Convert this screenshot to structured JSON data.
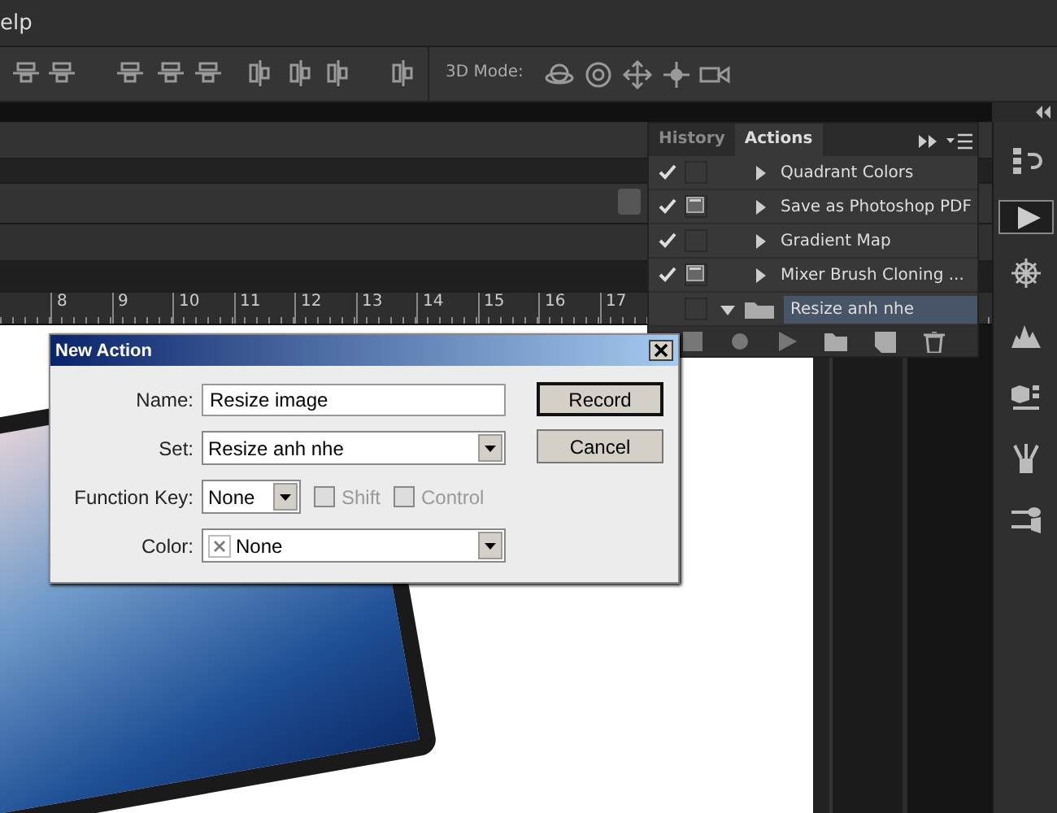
{
  "menu_bar": {
    "partial_item": "elp"
  },
  "options_bar": {
    "mode_label": "3D Mode:"
  },
  "ruler": {
    "ticks": [
      "8",
      "9",
      "10",
      "11",
      "12",
      "13",
      "14",
      "15",
      "16",
      "17"
    ]
  },
  "actions_panel": {
    "tabs": [
      {
        "label": "History",
        "selected": false
      },
      {
        "label": "Actions",
        "selected": true
      }
    ],
    "items": [
      {
        "kind": "action",
        "name": "Quadrant Colors",
        "enabled": true,
        "dialog": false,
        "expanded": false,
        "selected": false
      },
      {
        "kind": "action",
        "name": "Save as Photoshop PDF",
        "enabled": true,
        "dialog": true,
        "expanded": false,
        "selected": false
      },
      {
        "kind": "action",
        "name": "Gradient Map",
        "enabled": true,
        "dialog": false,
        "expanded": false,
        "selected": false
      },
      {
        "kind": "action",
        "name": "Mixer Brush Cloning ...",
        "enabled": true,
        "dialog": true,
        "expanded": false,
        "selected": false
      },
      {
        "kind": "set",
        "name": "Resize anh nhe",
        "enabled": false,
        "dialog": false,
        "expanded": true,
        "selected": true
      }
    ]
  },
  "dock": [
    {
      "kind": "history",
      "selected": false
    },
    {
      "kind": "actions",
      "selected": true
    },
    {
      "kind": "navigator",
      "selected": false
    },
    {
      "kind": "histogram",
      "selected": false
    },
    {
      "kind": "cube",
      "selected": false
    },
    {
      "kind": "brushes",
      "selected": false
    },
    {
      "kind": "presets",
      "selected": false
    }
  ],
  "dialog": {
    "title": "New Action",
    "fields": [
      {
        "kind": "text",
        "label": "Name:",
        "value": "Resize image"
      },
      {
        "kind": "select",
        "label": "Set:",
        "value": "Resize anh nhe"
      },
      {
        "kind": "fkey",
        "label": "Function Key:",
        "value": "None",
        "options": [
          {
            "label": "Shift",
            "checked": false,
            "disabled": true
          },
          {
            "label": "Control",
            "checked": false,
            "disabled": true
          }
        ]
      },
      {
        "kind": "color",
        "label": "Color:",
        "value": "None"
      }
    ],
    "buttons": [
      {
        "label": "Record",
        "default": true
      },
      {
        "label": "Cancel",
        "default": false
      }
    ]
  }
}
